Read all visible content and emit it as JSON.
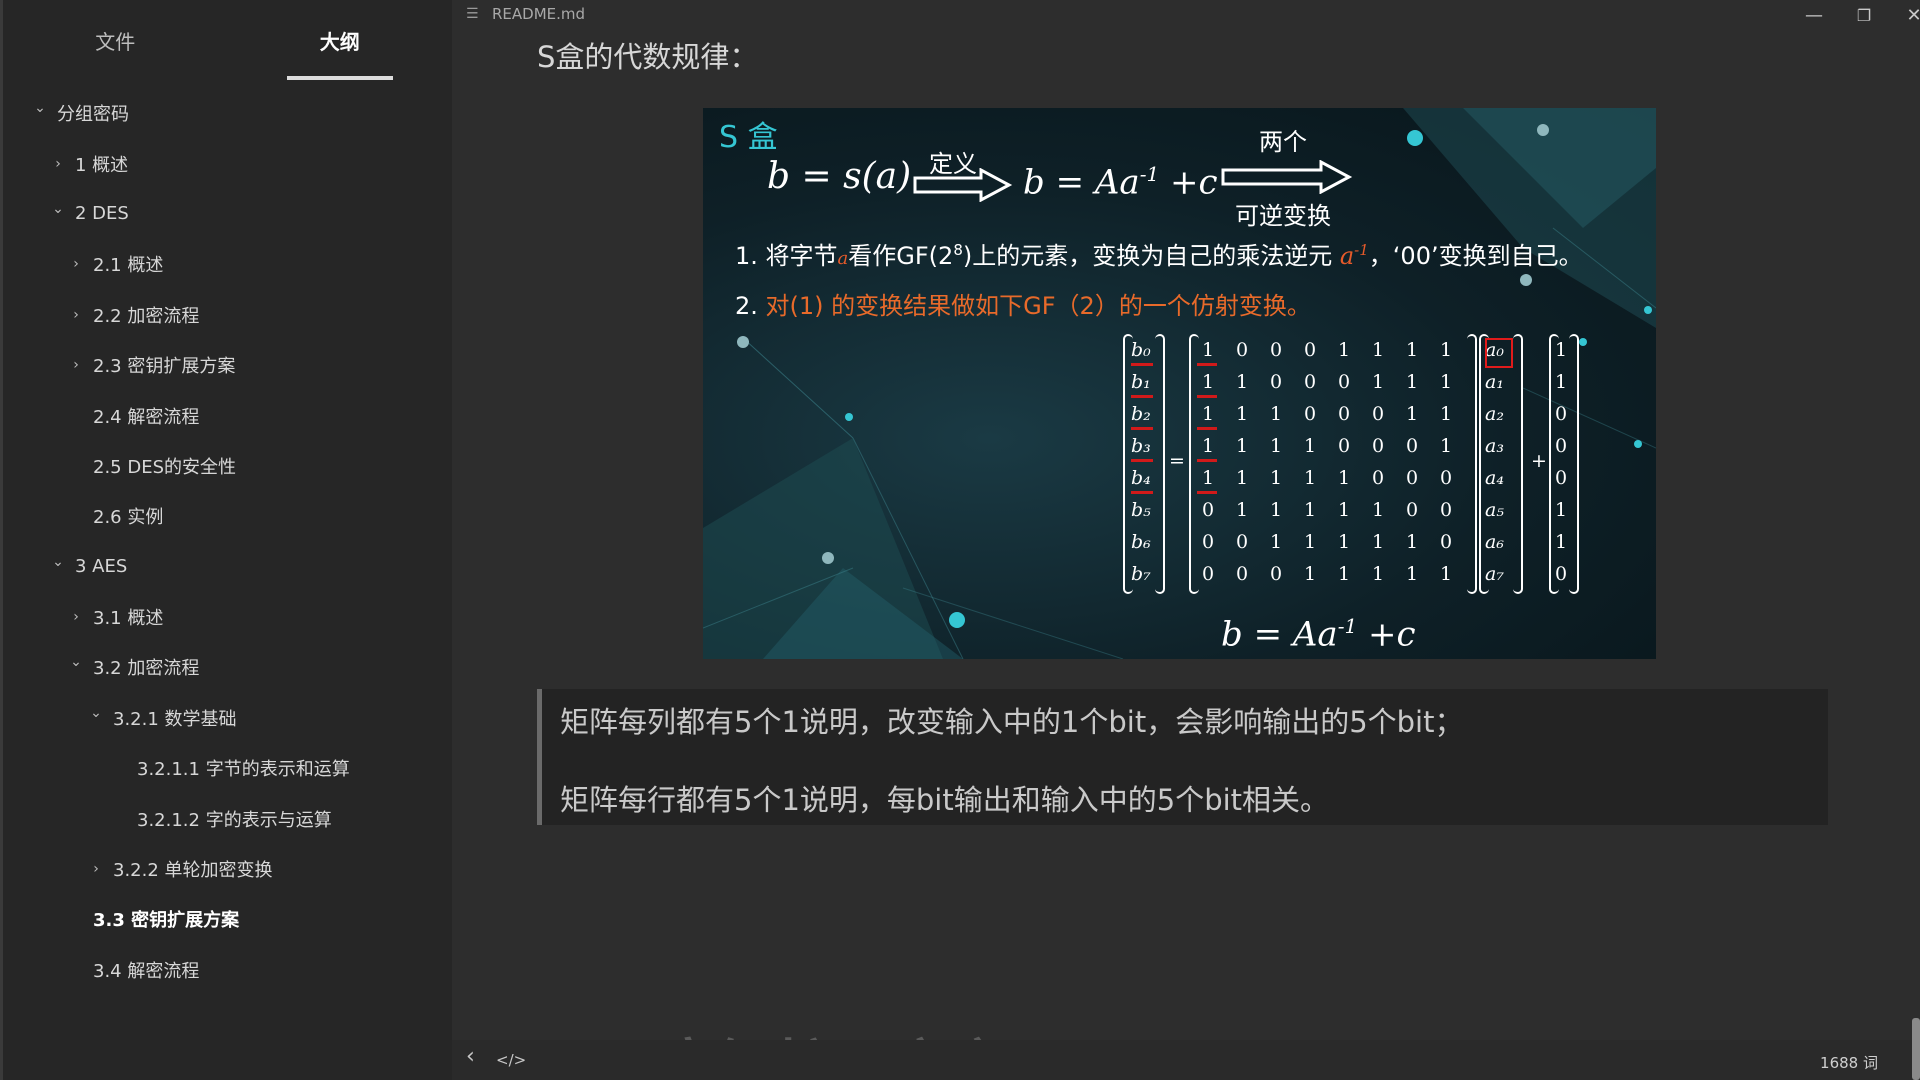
{
  "sidebar": {
    "tabs": [
      {
        "label": "文件",
        "active": false
      },
      {
        "label": "大纲",
        "active": true
      }
    ],
    "outline": [
      {
        "label": "分组密码",
        "level": 0,
        "chevron": "down"
      },
      {
        "label": "1 概述",
        "level": 1,
        "chevron": "right"
      },
      {
        "label": "2 DES",
        "level": 1,
        "chevron": "down"
      },
      {
        "label": "2.1 概述",
        "level": 2,
        "chevron": "right"
      },
      {
        "label": "2.2 加密流程",
        "level": 2,
        "chevron": "right"
      },
      {
        "label": "2.3 密钥扩展方案",
        "level": 2,
        "chevron": "right"
      },
      {
        "label": "2.4 解密流程",
        "level": 2,
        "chevron": "none"
      },
      {
        "label": "2.5 DES的安全性",
        "level": 2,
        "chevron": "none"
      },
      {
        "label": "2.6 实例",
        "level": 2,
        "chevron": "none"
      },
      {
        "label": "3 AES",
        "level": 1,
        "chevron": "down"
      },
      {
        "label": "3.1 概述",
        "level": 2,
        "chevron": "right"
      },
      {
        "label": "3.2 加密流程",
        "level": 2,
        "chevron": "down"
      },
      {
        "label": "3.2.1 数学基础",
        "level": 3,
        "chevron": "down"
      },
      {
        "label": "3.2.1.1 字节的表示和运算",
        "level": 4,
        "chevron": "none"
      },
      {
        "label": "3.2.1.2 字的表示与运算",
        "level": 4,
        "chevron": "none"
      },
      {
        "label": "3.2.2 单轮加密变换",
        "level": 3,
        "chevron": "right"
      },
      {
        "label": "3.3 密钥扩展方案",
        "level": 2,
        "chevron": "none",
        "bold": true
      },
      {
        "label": "3.4 解密流程",
        "level": 2,
        "chevron": "none"
      }
    ]
  },
  "titlebar": {
    "filename": "README.md",
    "doc_icon": "☰",
    "minimize": "—",
    "restore": "❐",
    "close": "✕"
  },
  "content": {
    "heading": "S盒的代数规律：",
    "slide": {
      "title": "S 盒",
      "eq1": "b = s(a)",
      "arrow1_label": "定义",
      "eq2": "b = Aa",
      "eq2_sup": "-1",
      "eq2_tail": " +c",
      "arrow2_top": "两个",
      "arrow2_bottom": "可逆变换",
      "line1_a": "1. 将字节",
      "line1_var": "a",
      "line1_b": "看作GF(2",
      "line1_sup": "8",
      "line1_c": ")上的元素，变换为自己的乘法逆元 ",
      "line1_inv": "a",
      "line1_inv_sup": "-1",
      "line1_d": "，‘00’变换到自己。",
      "line2_num": "2.",
      "line2_text": " 对(1) 的变换结果做如下GF（2）的一个仿射变换。",
      "b_vector": [
        "b₀",
        "b₁",
        "b₂",
        "b₃",
        "b₄",
        "b₅",
        "b₆",
        "b₇"
      ],
      "matrix": [
        [
          1,
          0,
          0,
          0,
          1,
          1,
          1,
          1
        ],
        [
          1,
          1,
          0,
          0,
          0,
          1,
          1,
          1
        ],
        [
          1,
          1,
          1,
          0,
          0,
          0,
          1,
          1
        ],
        [
          1,
          1,
          1,
          1,
          0,
          0,
          0,
          1
        ],
        [
          1,
          1,
          1,
          1,
          1,
          0,
          0,
          0
        ],
        [
          0,
          1,
          1,
          1,
          1,
          1,
          0,
          0
        ],
        [
          0,
          0,
          1,
          1,
          1,
          1,
          1,
          0
        ],
        [
          0,
          0,
          0,
          1,
          1,
          1,
          1,
          1
        ]
      ],
      "a_vector": [
        "a₀",
        "a₁",
        "a₂",
        "a₃",
        "a₄",
        "a₅",
        "a₆",
        "a₇"
      ],
      "c_vector": [
        1,
        1,
        0,
        0,
        0,
        1,
        1,
        0
      ],
      "equals": "=",
      "plus": "+",
      "bottom_eq": "b = Aa",
      "bottom_sup": "-1",
      "bottom_tail": " +c"
    },
    "quote_lines": [
      "矩阵每列都有5个1说明，改变输入中的1个bit，会影响输出的5个bit；",
      "矩阵每行都有5个1说明，每bit输出和输入中的5个bit相关。"
    ],
    "next_heading": "3.3 密钥扩展方案"
  },
  "statusbar": {
    "back": "‹",
    "source": "</>",
    "word_count": "1688 词"
  }
}
